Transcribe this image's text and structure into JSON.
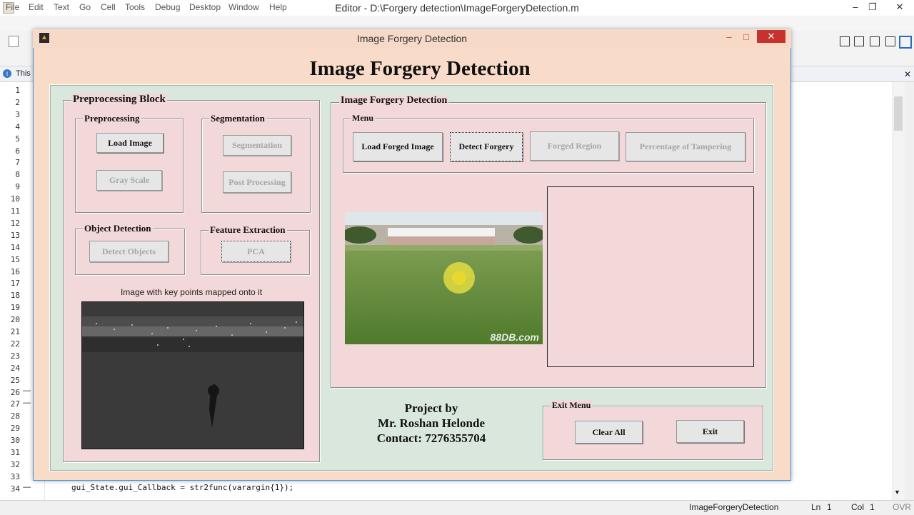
{
  "editor": {
    "title": "Editor - D:\\Forgery detection\\ImageForgeryDetection.m",
    "menu": [
      "File",
      "Edit",
      "Text",
      "Go",
      "Cell",
      "Tools",
      "Debug",
      "Desktop",
      "Window",
      "Help"
    ],
    "info_text": "This",
    "line_numbers": [
      "1",
      "2",
      "3",
      "4",
      "5",
      "6",
      "7",
      "8",
      "9",
      "10",
      "11",
      "12",
      "13",
      "14",
      "15",
      "16",
      "17",
      "18",
      "19",
      "20",
      "21",
      "22",
      "23",
      "24",
      "25",
      "26",
      "27",
      "28",
      "29",
      "30",
      "31",
      "32",
      "33",
      "34"
    ],
    "code_line": "gui_State.gui_Callback = str2func(varargin{1});",
    "status": {
      "file": "ImageForgeryDetection",
      "ln_label": "Ln",
      "ln": "1",
      "col_label": "Col",
      "col": "1",
      "mode": "OVR"
    }
  },
  "gui": {
    "window_title": "Image Forgery Detection",
    "heading": "Image Forgery Detection",
    "preprocessing_block": {
      "title": "Preprocessing Block",
      "preprocessing": {
        "title": "Preprocessing",
        "load_image": "Load Image",
        "gray_scale": "Gray Scale"
      },
      "segmentation": {
        "title": "Segmentation",
        "segmentation": "Segmentation",
        "post_processing": "Post Processing"
      },
      "object_detection": {
        "title": "Object Detection",
        "detect_objects": "Detect Objects"
      },
      "feature_extraction": {
        "title": "Feature Extraction",
        "pca": "PCA"
      },
      "keypoints_label": "Image with key points mapped onto it"
    },
    "detection_block": {
      "title": "Image Forgery Detection",
      "menu_title": "Menu",
      "load_forged": "Load Forged Image",
      "detect_forgery": "Detect Forgery",
      "forged_region": "Forged Region",
      "percentage": "Percentage of Tampering",
      "watermark": "88DB.com"
    },
    "project": {
      "line1": "Project by",
      "line2": "Mr. Roshan Helonde",
      "line3": "Contact: 7276355704"
    },
    "exit_menu": {
      "title": "Exit Menu",
      "clear_all": "Clear All",
      "exit": "Exit"
    }
  },
  "colors": {
    "window_bg": "#f8dcc9",
    "main_panel": "#d9e7dc",
    "subpanel": "#f2d8d8",
    "accent_border": "#4a90d9"
  }
}
